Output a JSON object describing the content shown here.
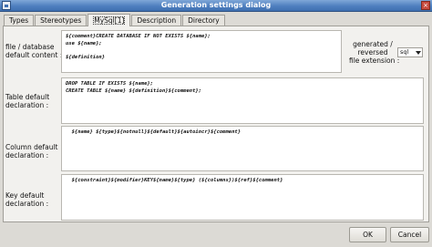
{
  "window": {
    "title": "Generation settings dialog"
  },
  "tabs": [
    {
      "label": "Types"
    },
    {
      "label": "Stereotypes"
    },
    {
      "label": "MySql[1]"
    },
    {
      "label": "Description"
    },
    {
      "label": "Directory"
    }
  ],
  "fields": {
    "file_db_label": "file / database\ndefault content :",
    "file_db_value": "${comment}CREATE DATABASE IF NOT EXISTS ${name};\nuse ${name};\n\n${definition}",
    "generated_label": "generated /\nreversed\nfile extension :",
    "file_extension": "sql",
    "table_label": "Table default\ndeclaration :",
    "table_value": "DROP TABLE IF EXISTS ${name};\nCREATE TABLE ${name} ${definition}${comment};",
    "column_label": "Column default\ndeclaration :",
    "column_value": "  ${name} ${type}${notnull}${default}${autoincr}${comment}",
    "key_label": "Key default\ndeclaration :",
    "key_value": "  ${constraint}${modifier}KEY${name}${type} (${columns})${ref}${comment}"
  },
  "buttons": {
    "ok": "OK",
    "cancel": "Cancel"
  }
}
